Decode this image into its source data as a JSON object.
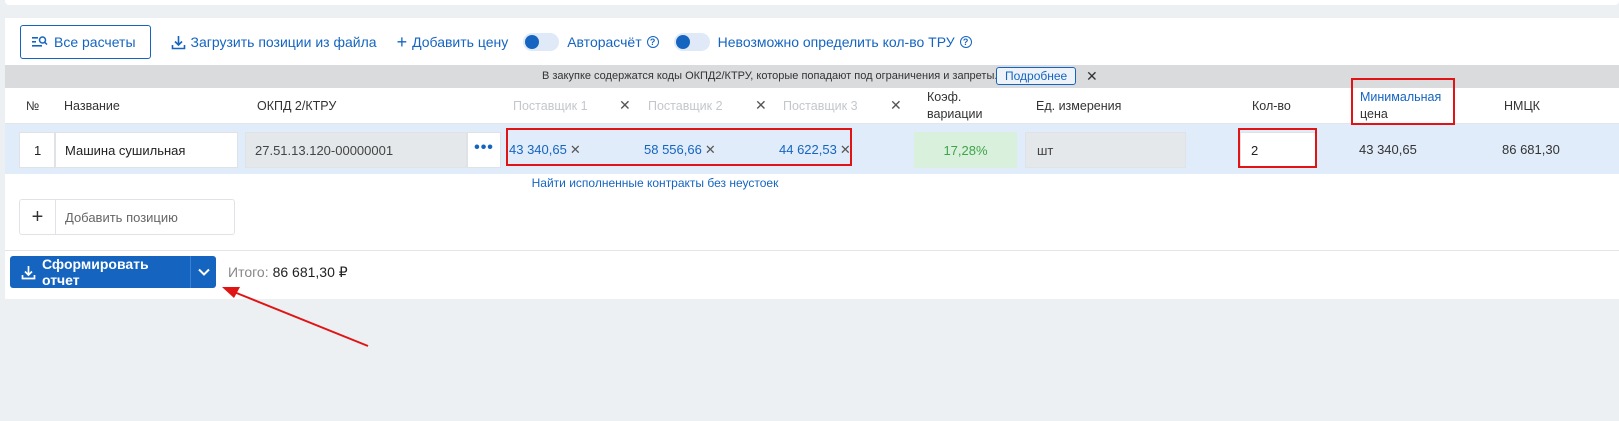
{
  "toolbar": {
    "all_calcs_label": "Все расчеты",
    "upload_label": "Загрузить позиции из файла",
    "add_price_label": "Добавить цену",
    "auto_calc_label": "Авторасчёт",
    "cannot_determine_label": "Невозможно определить кол-во ТРУ"
  },
  "notice": {
    "text": "В закупке содержатся коды ОКПД2/КТРУ, которые попадают под ограничения и запреты.",
    "more_label": "Подробнее"
  },
  "columns": {
    "num": "№",
    "name": "Название",
    "okpd": "ОКПД 2/КТРУ",
    "supplier1": "Поставщик 1",
    "supplier2": "Поставщик 2",
    "supplier3": "Поставщик 3",
    "koef_line1": "Коэф.",
    "koef_line2": "вариации",
    "unit": "Ед. измерения",
    "qty": "Кол-во",
    "minprice_line1": "Минимальная",
    "minprice_line2": "цена",
    "nmck": "НМЦК"
  },
  "row": {
    "num": "1",
    "name": "Машина сушильная",
    "okpd": "27.51.13.120-00000001",
    "price1": "43 340,65",
    "price2": "58 556,66",
    "price3": "44 622,53",
    "koef": "17,28%",
    "unit": "шт",
    "qty": "2",
    "min_price": "43 340,65",
    "nmck": "86 681,30"
  },
  "find_contracts_label": "Найти исполненные контракты без неустоек",
  "add_position_label": "Добавить позицию",
  "report_button_label": "Сформировать отчет",
  "total": {
    "label": "Итого:",
    "value": "86 681,30 ₽"
  },
  "colors": {
    "accent": "#1565c0",
    "annotation": "#e01414",
    "koef_good": "#3ea44a"
  }
}
